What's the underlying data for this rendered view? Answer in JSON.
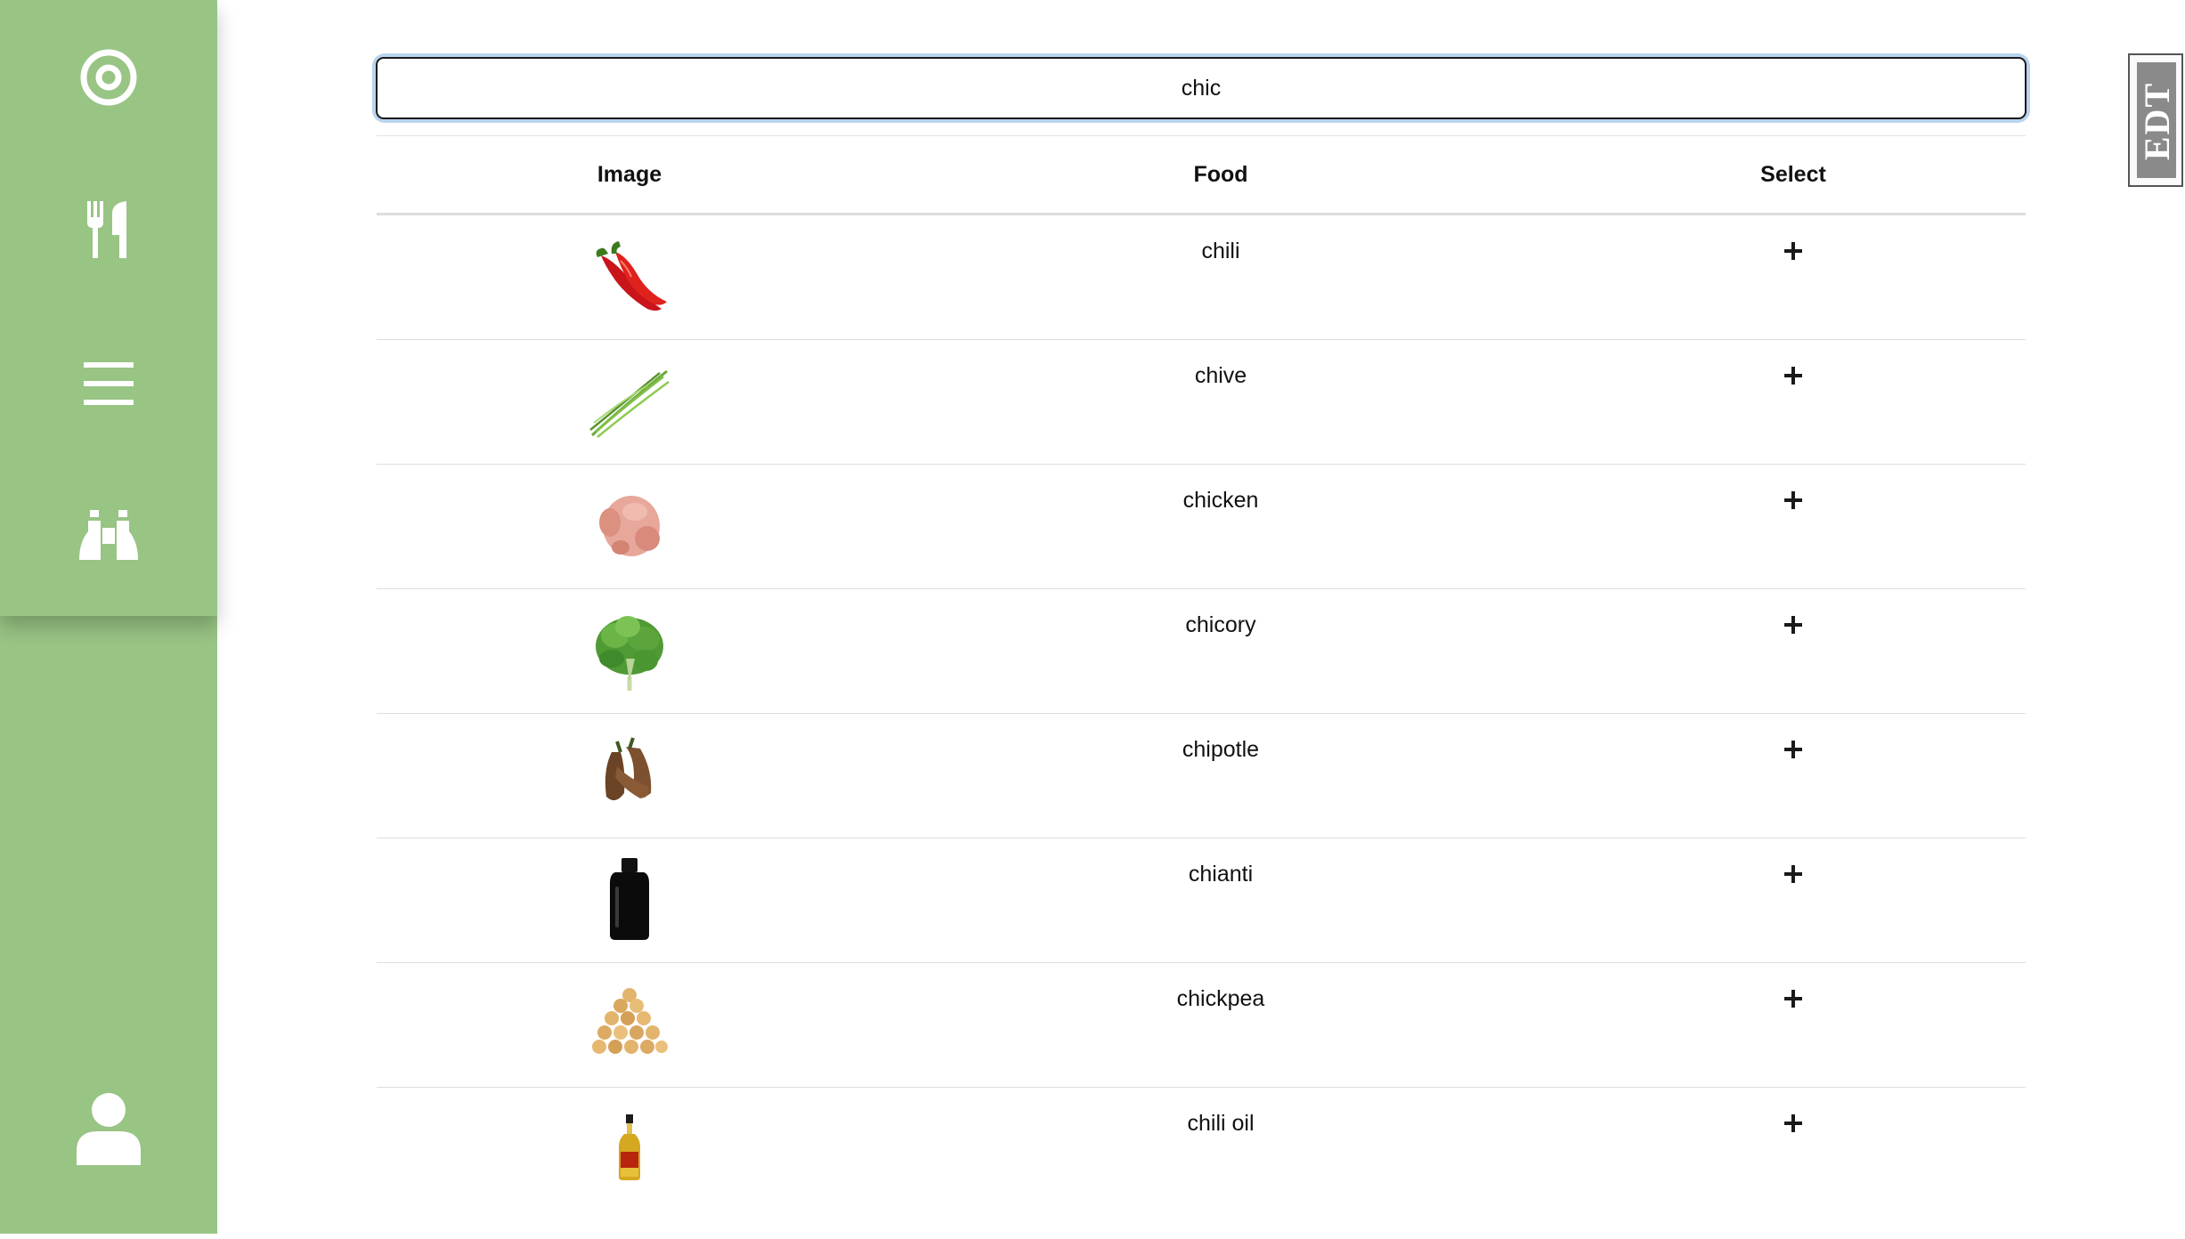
{
  "sidebar": {
    "items": [
      {
        "icon": "target-icon"
      },
      {
        "icon": "utensils-icon"
      },
      {
        "icon": "menu-icon"
      },
      {
        "icon": "binoculars-icon"
      }
    ],
    "profile_icon": "user-icon",
    "background": "#98c484"
  },
  "search": {
    "value": "chic"
  },
  "table": {
    "headers": {
      "image": "Image",
      "food": "Food",
      "select": "Select"
    },
    "rows": [
      {
        "food": "chili",
        "image": "red-chili-peppers"
      },
      {
        "food": "chive",
        "image": "chives"
      },
      {
        "food": "chicken",
        "image": "raw-chicken"
      },
      {
        "food": "chicory",
        "image": "chicory-leaves"
      },
      {
        "food": "chipotle",
        "image": "dried-chipotle-peppers"
      },
      {
        "food": "chianti",
        "image": "black-bottle"
      },
      {
        "food": "chickpea",
        "image": "chickpeas-pile"
      },
      {
        "food": "chili oil",
        "image": "chili-oil-bottle"
      }
    ],
    "select_icon": "plus-icon"
  },
  "edt_badge": "EDT"
}
